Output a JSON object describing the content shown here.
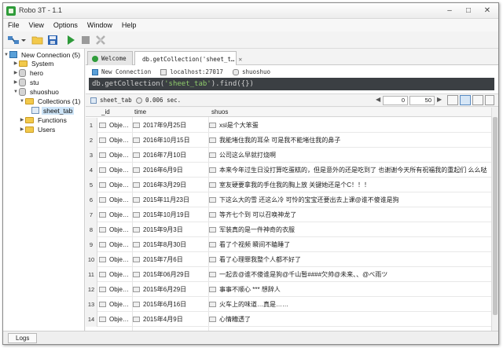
{
  "window": {
    "title": "Robo 3T - 1.1"
  },
  "menu": [
    "File",
    "View",
    "Options",
    "Window",
    "Help"
  ],
  "sidebar": {
    "connection": "New Connection (5)",
    "dbs": [
      "System",
      "hero",
      "stu",
      "shuoshuo"
    ],
    "collections": "Collections (1)",
    "selected_collection": "sheet_tab",
    "functions": "Functions",
    "users": "Users"
  },
  "tabs": [
    {
      "label": "Welcome"
    },
    {
      "label": "db.getCollection('sheet_t…"
    }
  ],
  "query": {
    "connection": "New Connection",
    "host": "localhost:27017",
    "db": "shuoshuo",
    "prefix": "db.getCollection(",
    "collection": "'sheet_tab'",
    "suffix": ").find({})"
  },
  "results": {
    "collection": "sheet_tab",
    "duration": "0.006 sec.",
    "skip": "0",
    "limit": "50"
  },
  "columns": [
    "_id",
    "time",
    "shuos"
  ],
  "rows": [
    {
      "num": "1",
      "id": "Obje…",
      "time": "2017年9月25日",
      "shuos": "xsl是个大笨蛋"
    },
    {
      "num": "2",
      "id": "Obje…",
      "time": "2016年10月15日",
      "shuos": "我能堵住我的耳朵 可是我不能堵住我的鼻子"
    },
    {
      "num": "3",
      "id": "Obje…",
      "time": "2016年7月10日",
      "shuos": "公司这么早就打烧啊"
    },
    {
      "num": "4",
      "id": "Obje…",
      "time": "2016年6月9日",
      "shuos": "本来今年过生日没打算吃蛋糕的，但是意外的还是吃到了 也谢谢今天所有祝福我的重起们 么么哒"
    },
    {
      "num": "5",
      "id": "Obje…",
      "time": "2016年3月29日",
      "shuos": "室友硬要拿我的手住我的胸上放 关键她还是个C！！！"
    },
    {
      "num": "6",
      "id": "Obje…",
      "time": "2015年11月23日",
      "shuos": "下这么大的雪 还这么冷 可怜的宝宝还要出去上课@谁不傻谁是狗"
    },
    {
      "num": "7",
      "id": "Obje…",
      "time": "2015年10月19日",
      "shuos": "等齐七个到 可以召唤神龙了"
    },
    {
      "num": "8",
      "id": "Obje…",
      "time": "2015年9月3日",
      "shuos": "军装真的是一件神奇的衣服"
    },
    {
      "num": "9",
      "id": "Obje…",
      "time": "2015年8月30日",
      "shuos": "看了个视频 瞬间不瞌睡了"
    },
    {
      "num": "10",
      "id": "Obje…",
      "time": "2015年7月6日",
      "shuos": "看了心理罪我整个人都不好了"
    },
    {
      "num": "11",
      "id": "Obje…",
      "time": "2015年06月29日",
      "shuos": "一起去@谁不傻谁是狗@千山暂####欠帅@未来、、@べ雨ツ"
    },
    {
      "num": "12",
      "id": "Obje…",
      "time": "2015年6月29日",
      "shuos": "事事不顺心 *** 想辞人"
    },
    {
      "num": "13",
      "id": "Obje…",
      "time": "2015年6月16日",
      "shuos": "火车上的味道…真是……"
    },
    {
      "num": "14",
      "id": "Obje…",
      "time": "2015年4月9日",
      "shuos": "心情糟透了"
    }
  ],
  "logs": {
    "label": "Logs"
  }
}
